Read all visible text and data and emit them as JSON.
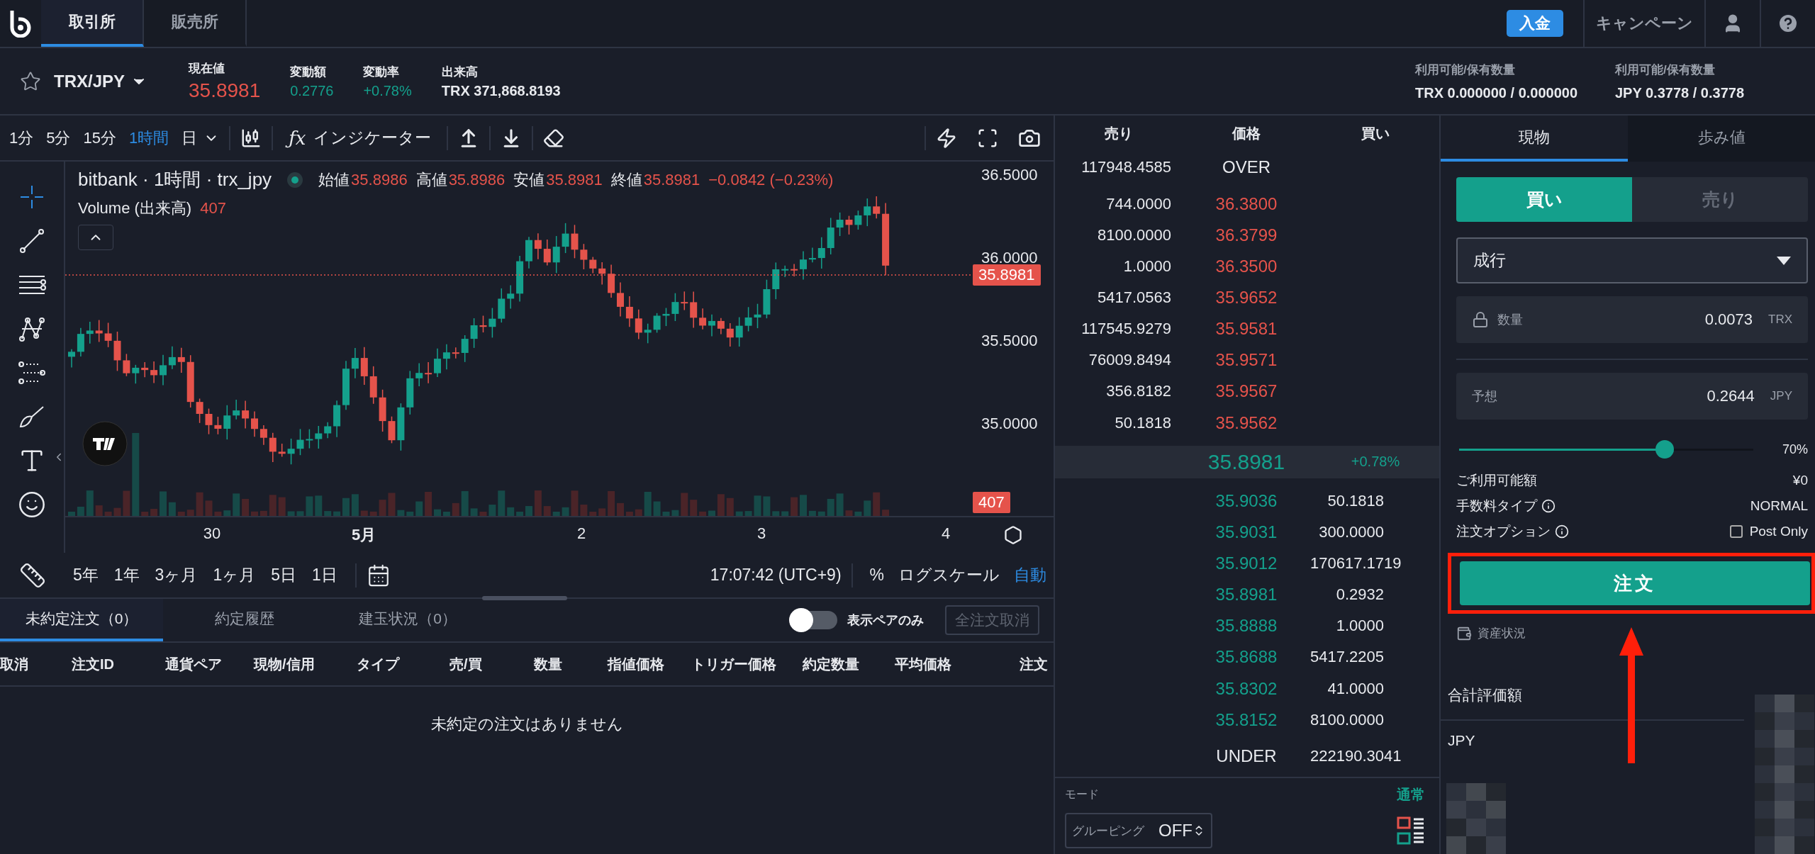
{
  "header": {
    "tabs": [
      {
        "label": "取引所",
        "selected": true
      },
      {
        "label": "販売所",
        "selected": false
      }
    ],
    "deposit_button": "入金",
    "campaign_link": "キャンペーン"
  },
  "ticker": {
    "pair": "TRX/JPY",
    "stats": [
      {
        "label": "現在値",
        "value": "35.8981",
        "kind": "price"
      },
      {
        "label": "変動額",
        "value": "0.2776",
        "kind": "change"
      },
      {
        "label": "変動率",
        "value": "+0.78%",
        "kind": "change"
      },
      {
        "label": "出来高",
        "value": "TRX 371,868.8193",
        "kind": "plain"
      }
    ],
    "balances": [
      {
        "label": "利用可能/保有数量",
        "value": "TRX 0.000000 / 0.000000"
      },
      {
        "label": "利用可能/保有数量",
        "value": "JPY 0.3778 / 0.3778"
      }
    ]
  },
  "chart_toolbar": {
    "intervals": [
      {
        "label": "1分",
        "selected": false
      },
      {
        "label": "5分",
        "selected": false
      },
      {
        "label": "15分",
        "selected": false
      },
      {
        "label": "1時間",
        "selected": true
      },
      {
        "label": "日",
        "selected": false
      }
    ],
    "indicator_icon": "ƒx",
    "indicator_button": "インジケーター"
  },
  "chart": {
    "legend_title": "bitbank · 1時間 · trx_jpy",
    "ohlc": [
      {
        "label": "始値",
        "value": "35.8986"
      },
      {
        "label": "高値",
        "value": "35.8986"
      },
      {
        "label": "安値",
        "value": "35.8981"
      },
      {
        "label": "終値",
        "value": "35.8981"
      }
    ],
    "change": "−0.0842 (−0.23%)",
    "volume_label": "Volume (出来高)",
    "volume_value": "407",
    "price_ticks": [
      "36.5000",
      "36.0000",
      "35.5000",
      "35.0000"
    ],
    "last_price_tag": "35.8981",
    "volume_tag": "407",
    "time_ticks": [
      {
        "label": "30",
        "emphasized": false
      },
      {
        "label": "5月",
        "emphasized": true
      },
      {
        "label": "2",
        "emphasized": false
      },
      {
        "label": "3",
        "emphasized": false
      },
      {
        "label": "4",
        "emphasized": false
      }
    ]
  },
  "time_bar": {
    "ranges": [
      "5年",
      "1年",
      "3ヶ月",
      "1ヶ月",
      "5日",
      "1日"
    ],
    "clock": "17:07:42 (UTC+9)",
    "percent": "%",
    "log_scale": "ログスケール",
    "auto": "自動"
  },
  "orders_panel": {
    "tabs": [
      {
        "label": "未約定注文（0）",
        "selected": true
      },
      {
        "label": "約定履歴",
        "selected": false
      },
      {
        "label": "建玉状況（0）",
        "selected": false
      }
    ],
    "pair_only_toggle": {
      "label": "表示ペアのみ",
      "on": false
    },
    "cancel_all_button": {
      "label": "全注文取消",
      "disabled": true
    },
    "columns": [
      "取消",
      "注文ID",
      "通貨ペア",
      "現物/信用",
      "タイプ",
      "売/買",
      "数量",
      "指値価格",
      "トリガー価格",
      "約定数量",
      "平均価格",
      "注文"
    ],
    "empty_message": "未約定の注文はありません"
  },
  "order_book": {
    "columns": [
      "売り",
      "価格",
      "買い"
    ],
    "over": {
      "size": "117948.4585",
      "label": "OVER"
    },
    "asks": [
      {
        "size": "744.0000",
        "price": "36.3800"
      },
      {
        "size": "8100.0000",
        "price": "36.3799"
      },
      {
        "size": "1.0000",
        "price": "36.3500"
      },
      {
        "size": "5417.0563",
        "price": "35.9652"
      },
      {
        "size": "117545.9279",
        "price": "35.9581"
      },
      {
        "size": "76009.8494",
        "price": "35.9571"
      },
      {
        "size": "356.8182",
        "price": "35.9567"
      },
      {
        "size": "50.1818",
        "price": "35.9562"
      }
    ],
    "last": {
      "price": "35.8981",
      "change": "+0.78%"
    },
    "bids": [
      {
        "price": "35.9036",
        "size": "50.1818"
      },
      {
        "price": "35.9031",
        "size": "300.0000"
      },
      {
        "price": "35.9012",
        "size": "170617.1719"
      },
      {
        "price": "35.8981",
        "size": "0.2932"
      },
      {
        "price": "35.8888",
        "size": "1.0000"
      },
      {
        "price": "35.8688",
        "size": "5417.2205"
      },
      {
        "price": "35.8302",
        "size": "41.0000"
      },
      {
        "price": "35.8152",
        "size": "8100.0000"
      }
    ],
    "under": {
      "label": "UNDER",
      "size": "222190.3041"
    },
    "mode_label": "モード",
    "mode_value": "通常",
    "grouping_label": "グルーピング",
    "grouping_value": "OFF"
  },
  "order_form": {
    "tabs": [
      {
        "label": "現物",
        "selected": true
      },
      {
        "label": "歩み値",
        "selected": false
      }
    ],
    "sides": [
      {
        "label": "買い",
        "selected": true
      },
      {
        "label": "売り",
        "selected": false
      }
    ],
    "order_type": "成行",
    "quantity": {
      "label": "数量",
      "value": "0.0073",
      "unit": "TRX"
    },
    "estimate": {
      "label": "予想",
      "value": "0.2644",
      "unit": "JPY"
    },
    "slider": {
      "level": 0.7,
      "reading": "70%"
    },
    "info": [
      {
        "label": "ご利用可能額",
        "value": "¥0",
        "info_icon": false
      },
      {
        "label": "手数料タイプ",
        "value": "NORMAL",
        "info_icon": true
      }
    ],
    "post_only": {
      "label": "注文オプション",
      "option": "Post Only",
      "checked": false
    },
    "submit_button": "注文",
    "assets_link": "資産状況",
    "total_label": "合計評価額",
    "currency": "JPY"
  }
}
